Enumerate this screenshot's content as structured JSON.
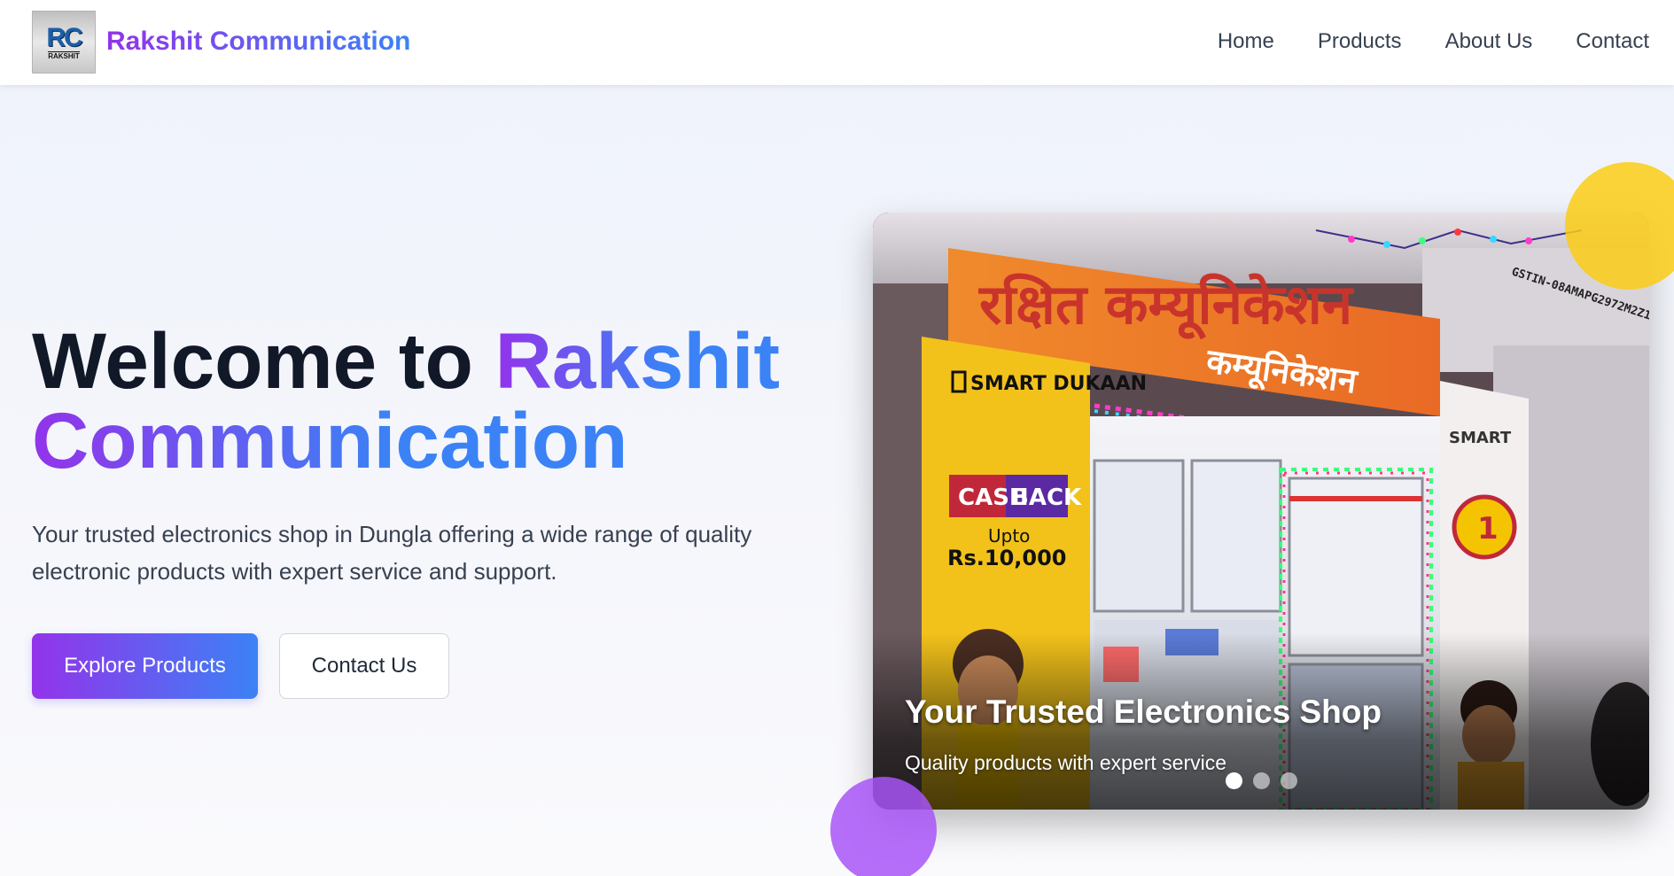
{
  "header": {
    "logo": {
      "mark": "RC",
      "sub": "RAKSHIT"
    },
    "brand_name": "Rakshit Communication",
    "nav": [
      {
        "label": "Home"
      },
      {
        "label": "Products"
      },
      {
        "label": "About Us"
      },
      {
        "label": "Contact"
      }
    ]
  },
  "hero": {
    "title_prefix": "Welcome to",
    "title_highlight_1": "Rakshit",
    "title_highlight_2": "Communication",
    "subtitle": "Your trusted electronics shop in Dungla offering a wide range of quality electronic products with expert service and support.",
    "primary_button": "Explore Products",
    "secondary_button": "Contact Us"
  },
  "carousel": {
    "slide_title": "Your Trusted Electronics Shop",
    "slide_description": "Quality products with expert service",
    "active_slide": 1,
    "slide_count": 3,
    "photo_signage": {
      "shop_sign_hindi": "रक्षित कम्यूनिकेशन",
      "smart_dukaan": "SMART DUKAAN",
      "cash": "CASH",
      "back": "BACK",
      "upto": "Upto",
      "amount": "Rs.10,000",
      "gstin": "GSTIN-08AMAPG2972M2Z1"
    }
  },
  "colors": {
    "brand_gradient_start": "#9333ea",
    "brand_gradient_end": "#3b82f6",
    "accent_yellow": "#facc15",
    "accent_purple": "#a855f7"
  }
}
